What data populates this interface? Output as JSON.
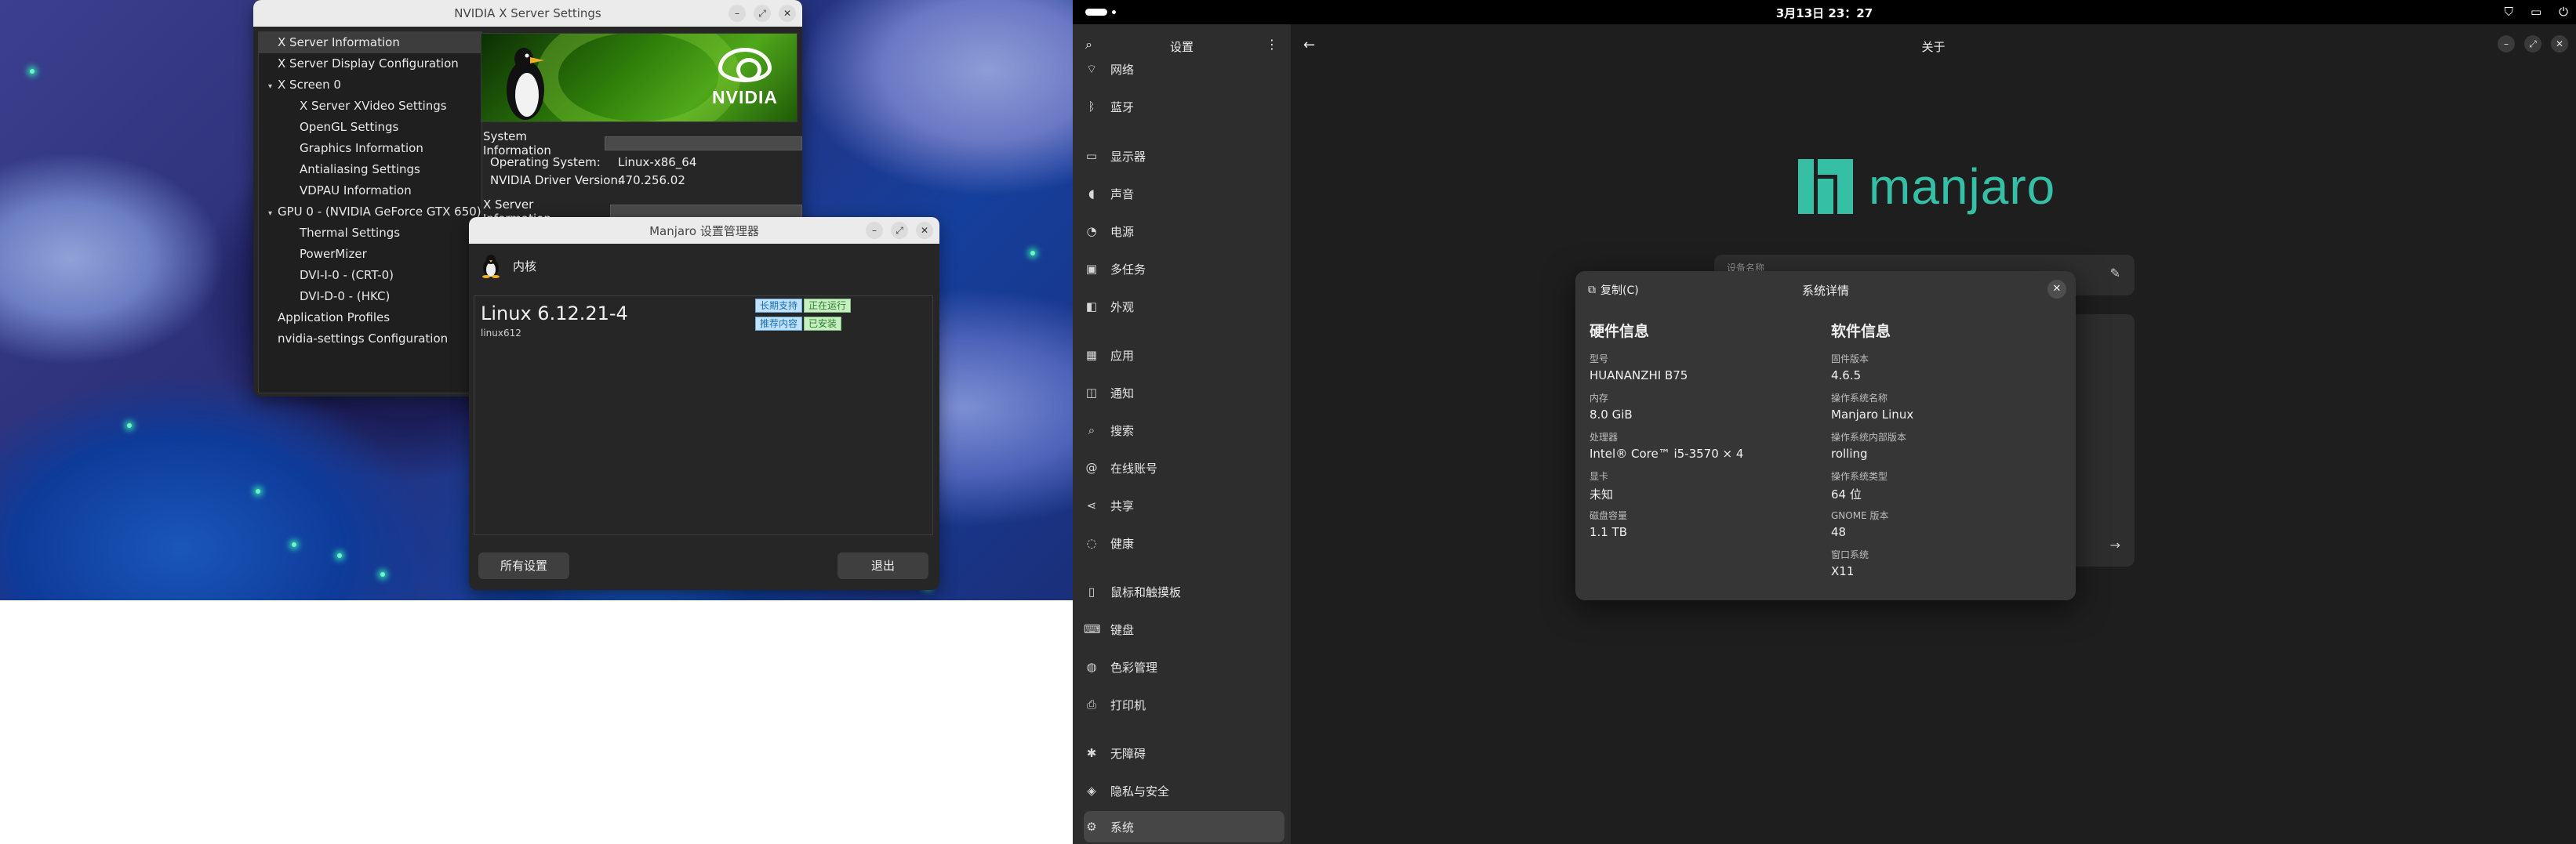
{
  "nvidia": {
    "title": "NVIDIA X Server Settings",
    "tree": [
      {
        "label": "X Server Information",
        "indent": 0,
        "selected": true,
        "arrow": ""
      },
      {
        "label": "X Server Display Configuration",
        "indent": 0,
        "arrow": ""
      },
      {
        "label": "X Screen 0",
        "indent": 0,
        "arrow": "▾"
      },
      {
        "label": "X Server XVideo Settings",
        "indent": 1,
        "arrow": ""
      },
      {
        "label": "OpenGL Settings",
        "indent": 1,
        "arrow": ""
      },
      {
        "label": "Graphics Information",
        "indent": 1,
        "arrow": ""
      },
      {
        "label": "Antialiasing Settings",
        "indent": 1,
        "arrow": ""
      },
      {
        "label": "VDPAU Information",
        "indent": 1,
        "arrow": ""
      },
      {
        "label": "GPU 0 - (NVIDIA GeForce GTX 650)",
        "indent": 0,
        "arrow": "▾"
      },
      {
        "label": "Thermal Settings",
        "indent": 1,
        "arrow": ""
      },
      {
        "label": "PowerMizer",
        "indent": 1,
        "arrow": ""
      },
      {
        "label": "DVI-I-0 - (CRT-0)",
        "indent": 1,
        "arrow": ""
      },
      {
        "label": "DVI-D-0 - (HKC)",
        "indent": 1,
        "arrow": ""
      },
      {
        "label": "Application Profiles",
        "indent": 0,
        "arrow": ""
      },
      {
        "label": "nvidia-settings Configuration",
        "indent": 0,
        "arrow": ""
      }
    ],
    "banner_logo": "NVIDIA",
    "system_information_label": "System Information",
    "os_label": "Operating System:",
    "os_value": "Linux-x86_64",
    "driver_label": "NVIDIA Driver Version:",
    "driver_value": "470.256.02",
    "xserver_info_label": "X Server Information"
  },
  "manjaro": {
    "title": "Manjaro 设置管理器",
    "section": "内核",
    "kernel_name": "Linux 6.12.21-4",
    "kernel_pkg": "linux612",
    "badge_lts": "长期支持",
    "badge_running": "正在运行",
    "badge_recommended": "推荐内容",
    "badge_installed": "已安装",
    "btn_all": "所有设置",
    "btn_quit": "退出"
  },
  "topbar": {
    "clock": "3月13日  23：27"
  },
  "gnome": {
    "sidebar_title": "设置",
    "items": [
      {
        "icon": "wifi-icon",
        "glyph": "⌔",
        "label": "网络"
      },
      {
        "icon": "bluetooth-icon",
        "glyph": "ᛒ",
        "label": "蓝牙"
      },
      {
        "icon": "display-icon",
        "glyph": "▭",
        "label": "显示器"
      },
      {
        "icon": "sound-icon",
        "glyph": "◖",
        "label": "声音"
      },
      {
        "icon": "power-icon",
        "glyph": "◔",
        "label": "电源"
      },
      {
        "icon": "multitasking-icon",
        "glyph": "▣",
        "label": "多任务"
      },
      {
        "icon": "appearance-icon",
        "glyph": "◧",
        "label": "外观"
      },
      {
        "icon": "apps-icon",
        "glyph": "▦",
        "label": "应用"
      },
      {
        "icon": "notifications-icon",
        "glyph": "◫",
        "label": "通知"
      },
      {
        "icon": "search-icon",
        "glyph": "⌕",
        "label": "搜索"
      },
      {
        "icon": "online-accounts-icon",
        "glyph": "@",
        "label": "在线账号"
      },
      {
        "icon": "sharing-icon",
        "glyph": "⋖",
        "label": "共享"
      },
      {
        "icon": "wellbeing-icon",
        "glyph": "◌",
        "label": "健康"
      },
      {
        "icon": "mouse-icon",
        "glyph": "▯",
        "label": "鼠标和触摸板"
      },
      {
        "icon": "keyboard-icon",
        "glyph": "⌨",
        "label": "键盘"
      },
      {
        "icon": "color-icon",
        "glyph": "◍",
        "label": "色彩管理"
      },
      {
        "icon": "printer-icon",
        "glyph": "⎙",
        "label": "打印机"
      },
      {
        "icon": "accessibility-icon",
        "glyph": "✱",
        "label": "无障碍"
      },
      {
        "icon": "privacy-icon",
        "glyph": "◈",
        "label": "隐私与安全"
      },
      {
        "icon": "system-icon",
        "glyph": "⚙",
        "label": "系统"
      }
    ],
    "content_title": "关于",
    "device_name_label": "设备名称",
    "logo_text": "manjaro"
  },
  "details": {
    "copy_label": "复制(C)",
    "title": "系统详情",
    "hw_title": "硬件信息",
    "sw_title": "软件信息",
    "hardware": [
      {
        "k": "型号",
        "v": "HUANANZHI B75"
      },
      {
        "k": "内存",
        "v": "8.0 GiB"
      },
      {
        "k": "处理器",
        "v": "Intel® Core™ i5-3570 × 4"
      },
      {
        "k": "显卡",
        "v": "未知"
      },
      {
        "k": "磁盘容量",
        "v": "1.1 TB"
      }
    ],
    "software": [
      {
        "k": "固件版本",
        "v": "4.6.5"
      },
      {
        "k": "操作系统名称",
        "v": "Manjaro Linux"
      },
      {
        "k": "操作系统内部版本",
        "v": "rolling"
      },
      {
        "k": "操作系统类型",
        "v": "64 位"
      },
      {
        "k": "GNOME 版本",
        "v": "48"
      },
      {
        "k": "窗口系统",
        "v": "X11"
      }
    ]
  },
  "colors": {
    "accent": "#35bfa4",
    "nvidia_green": "#76b900"
  }
}
